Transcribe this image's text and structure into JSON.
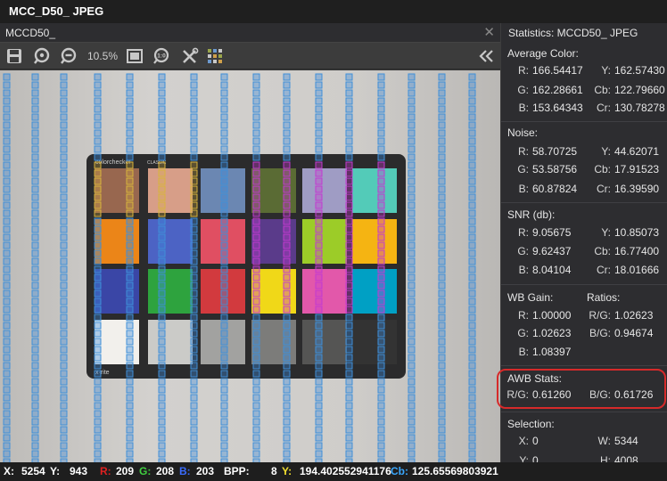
{
  "window": {
    "title": "MCC_D50_ JPEG"
  },
  "image_pane": {
    "tab_title": "MCCD50_",
    "close_glyph": "✕"
  },
  "toolbar": {
    "zoom_level": "10.5%",
    "icons": [
      "save-icon",
      "zoom-in-icon",
      "zoom-out-icon",
      "fit-window-icon",
      "actual-size-icon",
      "tools-icon",
      "grid-icon",
      "collapse-icon"
    ]
  },
  "checker": {
    "brand_text": "colorchecker",
    "model_badge": "CLASSIC",
    "footer_text": "x·rite"
  },
  "stats": {
    "header": "Statistics: MCCD50_ JPEG",
    "average": {
      "title": "Average Color:",
      "r": "166.54417",
      "y": "162.57430",
      "g": "162.28661",
      "cb": "122.79660",
      "b": "153.64343",
      "cr": "130.78278"
    },
    "noise": {
      "title": "Noise:",
      "r": "58.70725",
      "y": "44.62071",
      "g": "53.58756",
      "cb": "17.91523",
      "b": "60.87824",
      "cr": "16.39590"
    },
    "snr": {
      "title": "SNR (db):",
      "r": "9.05675",
      "y": "10.85073",
      "g": "9.62437",
      "cb": "16.77400",
      "b": "8.04104",
      "cr": "18.01666"
    },
    "wb": {
      "title": "WB Gain:",
      "ratios_title": "Ratios:",
      "r": "1.00000",
      "rg": "1.02623",
      "g": "1.02623",
      "bg": "0.94674",
      "b": "1.08397"
    },
    "awb": {
      "title": "AWB Stats:",
      "rg": "0.61260",
      "bg": "0.61726"
    },
    "selection": {
      "title": "Selection:",
      "x": "0",
      "w": "5344",
      "y": "0",
      "h": "4008"
    },
    "labels": {
      "r": "R:",
      "g": "G:",
      "b": "B:",
      "y": "Y:",
      "cb": "Cb:",
      "cr": "Cr:",
      "rg": "R/G:",
      "bg": "B/G:",
      "x": "X:",
      "w": "W:",
      "h": "H:"
    }
  },
  "statusbar": {
    "x_label": "X:",
    "x": "5254",
    "y_label": "Y:",
    "y": "943",
    "r_label": "R:",
    "r": "209",
    "g_label": "G:",
    "g": "208",
    "b_label": "B:",
    "b": "203",
    "bpp_label": "BPP:",
    "bpp": "8",
    "yy_label": "Y:",
    "yy": "194.402552941176",
    "cb_label": "Cb:",
    "cb": "125.65569803921",
    "colors": {
      "r": "#e02020",
      "g": "#40d040",
      "b": "#3a6cff",
      "y": "#f2e030",
      "cb": "#3aa8ff"
    }
  },
  "patches": [
    "#98674f",
    "#d79e88",
    "#6b87b2",
    "#5a6b34",
    "#9f9cc4",
    "#53cbb8",
    "#eb8518",
    "#4c63c4",
    "#e04f62",
    "#5a3b8a",
    "#9ccc28",
    "#f5b412",
    "#3a46a6",
    "#2ea33e",
    "#d23a3e",
    "#f0d818",
    "#e258aa",
    "#00a0c4",
    "#f2f0ec",
    "#cbcbc8",
    "#a2a2a0",
    "#7c7c7a",
    "#555554",
    "#333333"
  ]
}
